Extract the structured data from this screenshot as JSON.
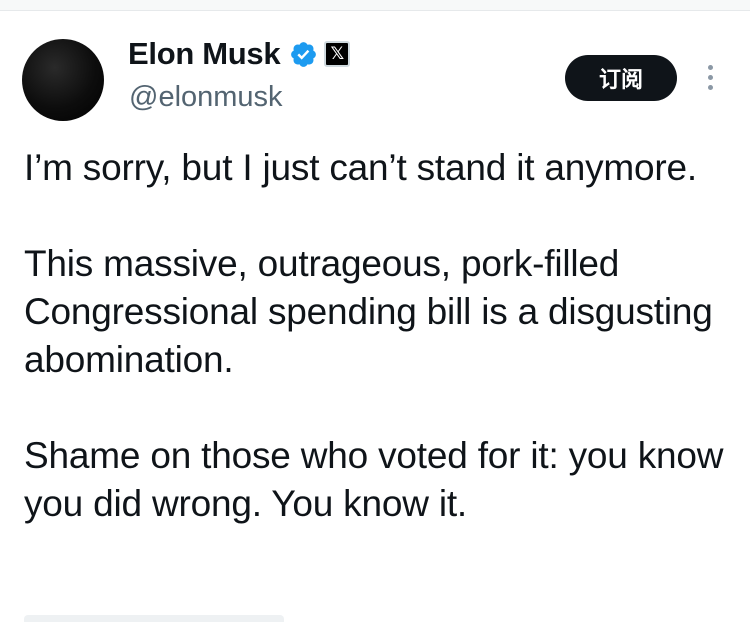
{
  "author": {
    "display_name": "Elon Musk",
    "handle": "@elonmusk",
    "verified_icon": "verified-badge-icon",
    "affiliation_icon": "x-logo-icon",
    "affiliation_glyph": "𝕏"
  },
  "actions": {
    "subscribe_label": "订阅",
    "more_icon": "more-vertical-icon"
  },
  "tweet": {
    "paragraphs": [
      "I’m sorry, but I just can’t stand it anymore.",
      "This massive, outrageous, pork-filled Congressional spending bill is a disgusting abomination.",
      "Shame on those who voted for it: you know you did wrong. You know it."
    ]
  },
  "colors": {
    "text": "#0f1419",
    "secondary_text": "#536471",
    "verified_blue": "#1d9bf0",
    "button_bg": "#0f1419"
  }
}
